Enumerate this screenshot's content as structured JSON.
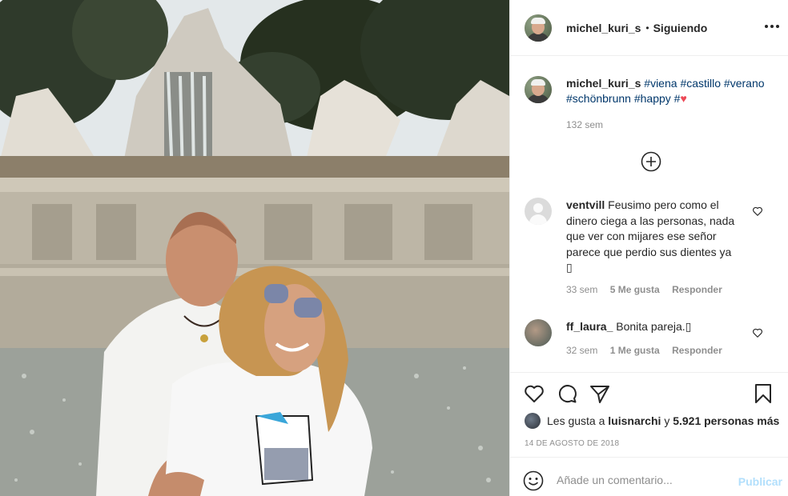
{
  "header": {
    "username": "michel_kuri_s",
    "separator": "•",
    "follow_label": "Siguiendo",
    "more_icon": "more-horizontal-icon"
  },
  "caption": {
    "username": "michel_kuri_s",
    "tags": [
      "#viena",
      "#castillo",
      "#verano",
      "#schönbrunn",
      "#happy",
      "#"
    ],
    "emoji": "♥",
    "time": "132 sem"
  },
  "load_more_icon": "plus-circle-icon",
  "comments": [
    {
      "username": "ventvill",
      "text": "Feusimo pero como el dinero ciega a las personas, nada que ver con mijares ese señor parece que perdio sus dientes ya",
      "trailing": "▯",
      "time": "33 sem",
      "likes": "5 Me gusta",
      "reply": "Responder"
    },
    {
      "username": "ff_laura_",
      "text": "Bonita pareja.",
      "trailing": "▯",
      "time": "32 sem",
      "likes": "1 Me gusta",
      "reply": "Responder"
    }
  ],
  "actions": {
    "likes_prefix": "Les gusta a",
    "likes_user": "luisnarchi",
    "likes_connector": "y",
    "likes_count": "5.921 personas más",
    "date": "14 DE AGOSTO DE 2018"
  },
  "add_comment": {
    "placeholder": "Añade un comentario...",
    "publish_label": "Publicar"
  },
  "colors": {
    "link": "#00376b",
    "muted": "#8e8e8e",
    "heart": "#ed4956",
    "publish_disabled": "#b2dffc"
  }
}
